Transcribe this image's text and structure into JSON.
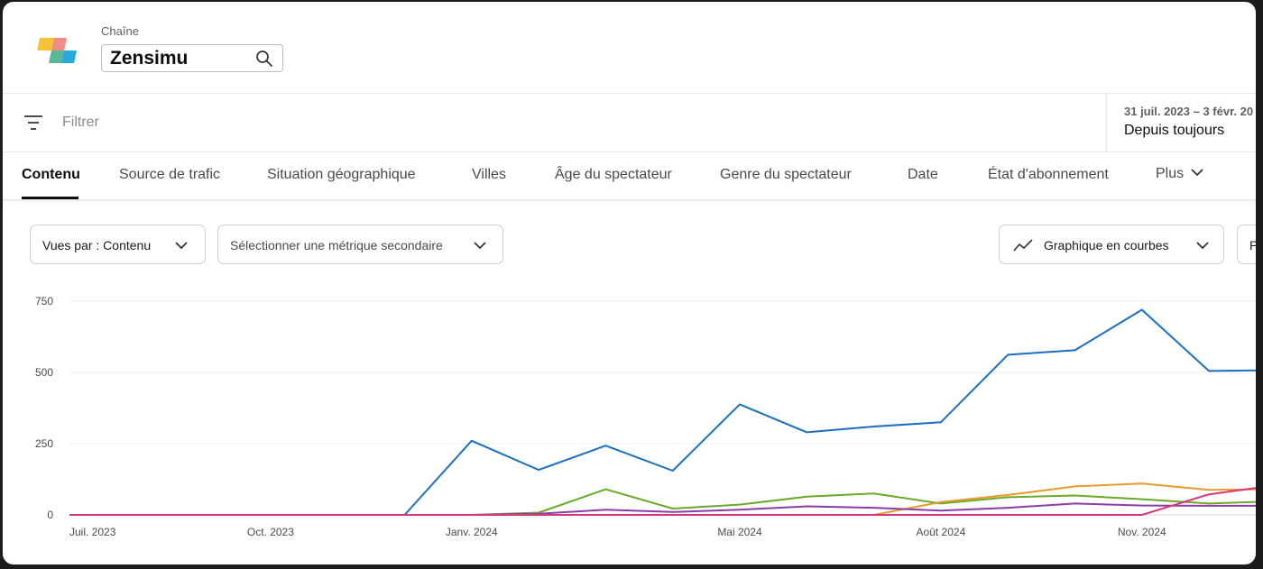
{
  "header": {
    "channel_label": "Chaîne",
    "channel_name": "Zensimu"
  },
  "filter": {
    "placeholder": "Filtrer",
    "date_range": "31 juil. 2023 – 3 févr. 20",
    "period": "Depuis toujours"
  },
  "tabs": [
    {
      "label": "Contenu",
      "active": true
    },
    {
      "label": "Source de trafic"
    },
    {
      "label": "Situation géographique"
    },
    {
      "label": "Villes"
    },
    {
      "label": "Âge du spectateur"
    },
    {
      "label": "Genre du spectateur"
    },
    {
      "label": "Date"
    },
    {
      "label": "État d'abonnement"
    },
    {
      "label": "Plus"
    }
  ],
  "controls": {
    "views_by": "Vues par : Contenu",
    "secondary_metric": "Sélectionner une métrique secondaire",
    "chart_type": "Graphique en courbes",
    "partial_button": "P"
  },
  "icons": {
    "filter": "filter-lines-icon",
    "search": "search-icon",
    "chevron": "chevron-down-icon",
    "line_chart": "line-chart-icon"
  },
  "colors": {
    "blue": "#1a6fc0",
    "green": "#6aaa2a",
    "orange": "#e49b2c",
    "purple": "#8e3aa8",
    "pink": "#d5377e"
  },
  "chart_data": {
    "type": "line",
    "x": [
      "2023-07",
      "2023-08",
      "2023-09",
      "2023-10",
      "2023-11",
      "2023-12",
      "2024-01",
      "2024-02",
      "2024-03",
      "2024-04",
      "2024-05",
      "2024-06",
      "2024-07",
      "2024-08",
      "2024-09",
      "2024-10",
      "2024-11",
      "2024-12",
      "2025-01"
    ],
    "x_tick_labels": [
      {
        "x": "2023-07",
        "label": "Juil. 2023"
      },
      {
        "x": "2023-10",
        "label": "Oct. 2023"
      },
      {
        "x": "2024-01",
        "label": "Janv. 2024"
      },
      {
        "x": "2024-05",
        "label": "Mai 2024"
      },
      {
        "x": "2024-08",
        "label": "Août 2024"
      },
      {
        "x": "2024-11",
        "label": "Nov. 2024"
      }
    ],
    "y_ticks": [
      0,
      250,
      500,
      750
    ],
    "ylim": [
      0,
      750
    ],
    "grid": true,
    "series": [
      {
        "color": "#1a6fc0",
        "values": [
          0,
          0,
          0,
          0,
          0,
          0,
          260,
          158,
          243,
          155,
          388,
          290,
          310,
          325,
          562,
          578,
          720,
          505,
          508
        ]
      },
      {
        "color": "#6aaa2a",
        "values": [
          0,
          0,
          0,
          0,
          0,
          0,
          0,
          8,
          90,
          22,
          36,
          64,
          75,
          40,
          62,
          68,
          55,
          40,
          48
        ]
      },
      {
        "color": "#e49b2c",
        "values": [
          0,
          0,
          0,
          0,
          0,
          0,
          0,
          0,
          0,
          0,
          0,
          0,
          0,
          45,
          70,
          100,
          110,
          88,
          90
        ]
      },
      {
        "color": "#8e3aa8",
        "values": [
          0,
          0,
          0,
          0,
          0,
          0,
          0,
          4,
          18,
          10,
          18,
          30,
          25,
          15,
          25,
          40,
          33,
          32,
          32
        ]
      },
      {
        "color": "#d5377e",
        "values": [
          0,
          0,
          0,
          0,
          0,
          0,
          0,
          0,
          0,
          0,
          0,
          0,
          0,
          0,
          0,
          0,
          0,
          72,
          104
        ]
      }
    ]
  }
}
